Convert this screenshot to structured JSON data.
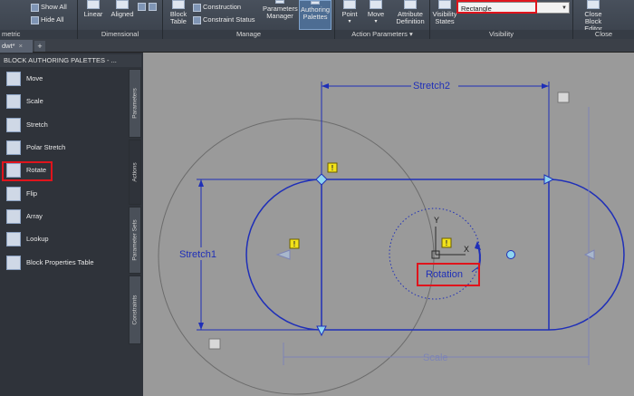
{
  "ribbon": {
    "left_partial": "metric",
    "show_all": "Show All",
    "hide_all": "Hide All",
    "dimensional": {
      "title": "Dimensional",
      "linear": "Linear",
      "aligned": "Aligned"
    },
    "manage": {
      "title": "Manage",
      "block_table": "Block\nTable",
      "construction": "Construction",
      "constraint_status": "Constraint Status",
      "parameters_manager": "Parameters\nManager",
      "authoring_palettes": "Authoring\nPalettes"
    },
    "action_parameters": {
      "title": "Action Parameters",
      "point": "Point",
      "move": "Move",
      "attribute_definition": "Attribute\nDefinition"
    },
    "visibility": {
      "title": "Visibility",
      "visibility_states": "Visibility\nStates",
      "dropdown_value": "Rectangle"
    },
    "close": {
      "title": "Close",
      "close_block_editor": "Close\nBlock Editor"
    }
  },
  "tabs": {
    "doc_tab": "dwt*",
    "doc_tab_close": "×",
    "new_tab": "+"
  },
  "palette": {
    "header": "BLOCK AUTHORING PALETTES - ...",
    "items": [
      {
        "label": "Move"
      },
      {
        "label": "Scale"
      },
      {
        "label": "Stretch"
      },
      {
        "label": "Polar Stretch"
      },
      {
        "label": "Rotate"
      },
      {
        "label": "Flip"
      },
      {
        "label": "Array"
      },
      {
        "label": "Lookup"
      },
      {
        "label": "Block Properties Table"
      }
    ],
    "side_tabs": [
      "Parameters",
      "Actions",
      "Parameter Sets",
      "Constraints"
    ]
  },
  "canvas": {
    "stretch2": "Stretch2",
    "stretch1": "Stretch1",
    "rotation": "Rotation",
    "scale": "Scale",
    "ucs_y": "Y",
    "ucs_x": "X",
    "warning_mark": "!"
  },
  "colors": {
    "highlight": "#e0141c",
    "dimension": "#1f2fb8",
    "canvas": "#9a9a9a"
  }
}
